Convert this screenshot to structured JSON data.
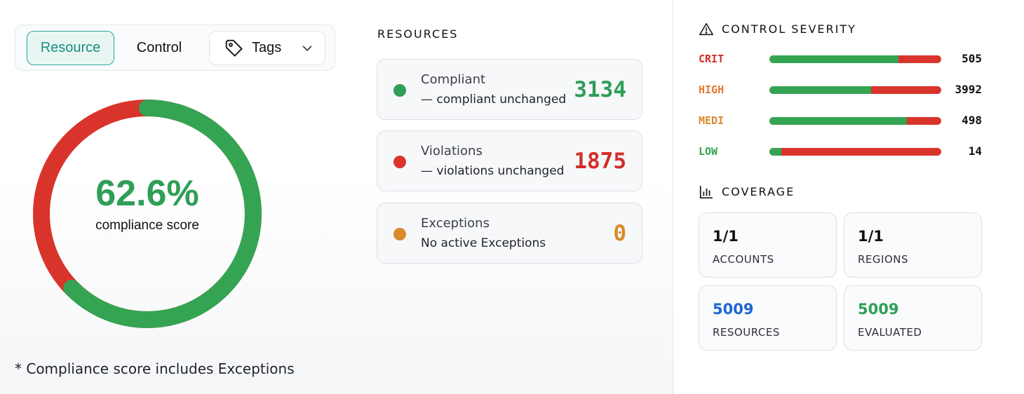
{
  "tabs": {
    "resource": "Resource",
    "control": "Control",
    "tags": "Tags"
  },
  "score": {
    "value": "62.6%",
    "caption": "compliance score",
    "fraction": 0.626,
    "colors": {
      "compliant": "#34a453",
      "violation": "#d9342b"
    }
  },
  "footnote": "* Compliance score includes Exceptions",
  "resources": {
    "title": "RESOURCES",
    "cards": [
      {
        "label": "Compliant",
        "sub": "— compliant unchanged",
        "value": "3134",
        "color": "#2f9e57"
      },
      {
        "label": "Violations",
        "sub": "— violations unchanged",
        "value": "1875",
        "color": "#d12f27"
      },
      {
        "label": "Exceptions",
        "sub": "No active Exceptions",
        "value": "0",
        "color": "#d98a2b"
      }
    ]
  },
  "severity": {
    "title": "CONTROL SEVERITY",
    "rows": [
      {
        "label": "CRIT",
        "count": "505",
        "compliant_fraction": 0.75,
        "color": "#d12f27"
      },
      {
        "label": "HIGH",
        "count": "3992",
        "compliant_fraction": 0.59,
        "color": "#e07a2e"
      },
      {
        "label": "MEDI",
        "count": "498",
        "compliant_fraction": 0.8,
        "color": "#d98a2b"
      },
      {
        "label": "LOW",
        "count": "14",
        "compliant_fraction": 0.07,
        "color": "#34a453"
      }
    ]
  },
  "coverage": {
    "title": "COVERAGE",
    "tiles": [
      {
        "value": "1/1",
        "label": "ACCOUNTS",
        "color": "#111111"
      },
      {
        "value": "1/1",
        "label": "REGIONS",
        "color": "#111111"
      },
      {
        "value": "5009",
        "label": "RESOURCES",
        "color": "#1f67d2"
      },
      {
        "value": "5009",
        "label": "EVALUATED",
        "color": "#2f9e57"
      }
    ]
  }
}
